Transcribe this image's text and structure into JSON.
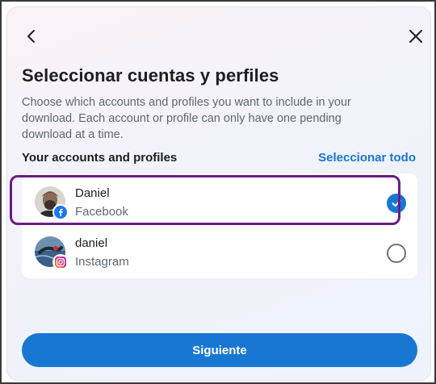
{
  "header": {
    "back_icon": "chevron-left-icon",
    "close_icon": "close-icon"
  },
  "title": "Seleccionar cuentas y perfiles",
  "description": "Choose which accounts and profiles you want to include in your download. Each account or profile can only have one pending download at a time.",
  "section": {
    "label": "Your accounts and profiles",
    "select_all": "Seleccionar todo"
  },
  "accounts": [
    {
      "name": "Daniel",
      "platform": "Facebook",
      "badge_icon": "facebook-icon",
      "selected": true
    },
    {
      "name": "daniel",
      "platform": "Instagram",
      "badge_icon": "instagram-icon",
      "selected": false
    }
  ],
  "footer": {
    "next_label": "Siguiente"
  },
  "colors": {
    "accent": "#1877d2",
    "highlight": "#6b1a86"
  }
}
